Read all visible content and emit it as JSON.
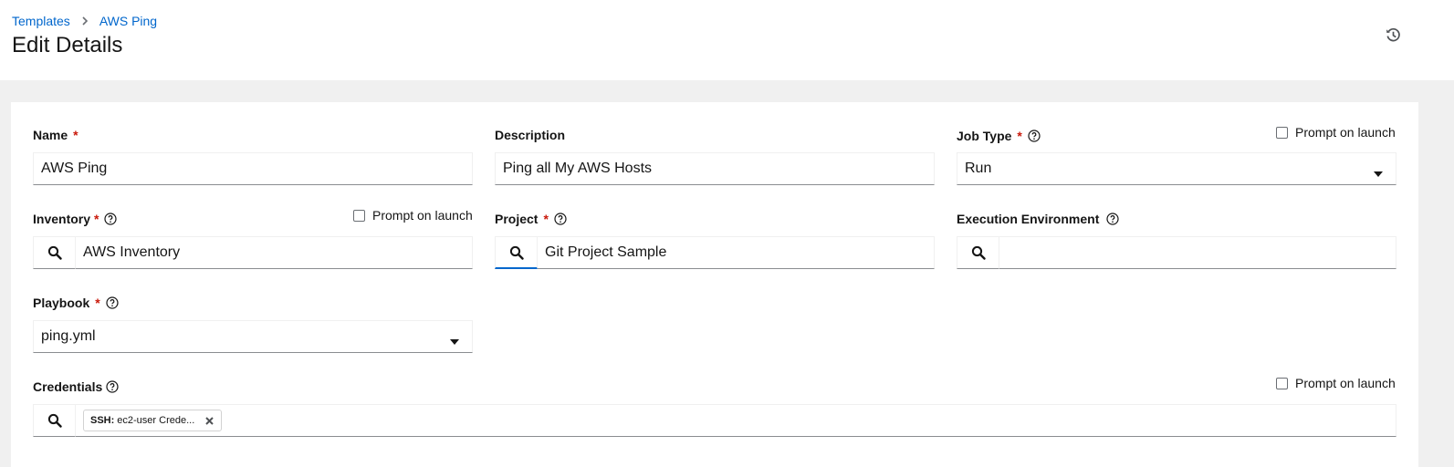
{
  "breadcrumb": {
    "parent": "Templates",
    "current": "AWS Ping"
  },
  "page": {
    "title": "Edit Details"
  },
  "colors": {
    "link": "#0066cc",
    "required": "#c9190b",
    "active_border": "#0066cc"
  },
  "form": {
    "name": {
      "label": "Name",
      "required": "*",
      "value": "AWS Ping"
    },
    "description": {
      "label": "Description",
      "value": "Ping all My AWS Hosts"
    },
    "job_type": {
      "label": "Job Type",
      "required": "*",
      "value": "Run",
      "prompt_label": "Prompt on launch"
    },
    "inventory": {
      "label": "Inventory",
      "required": "*",
      "value": "AWS Inventory",
      "prompt_label": "Prompt on launch"
    },
    "project": {
      "label": "Project",
      "required": "*",
      "value": "Git Project Sample"
    },
    "execution_environment": {
      "label": "Execution Environment",
      "value": ""
    },
    "playbook": {
      "label": "Playbook",
      "required": "*",
      "value": "ping.yml"
    },
    "credentials": {
      "label": "Credentials",
      "prompt_label": "Prompt on launch",
      "chips": [
        {
          "type": "SSH:",
          "name": "ec2-user Crede..."
        }
      ]
    }
  },
  "icons": {
    "history": "history-icon",
    "help": "question-circle-icon",
    "search": "search-icon",
    "caret": "caret-down-icon",
    "remove": "times-icon",
    "separator": "chevron-right-icon"
  }
}
